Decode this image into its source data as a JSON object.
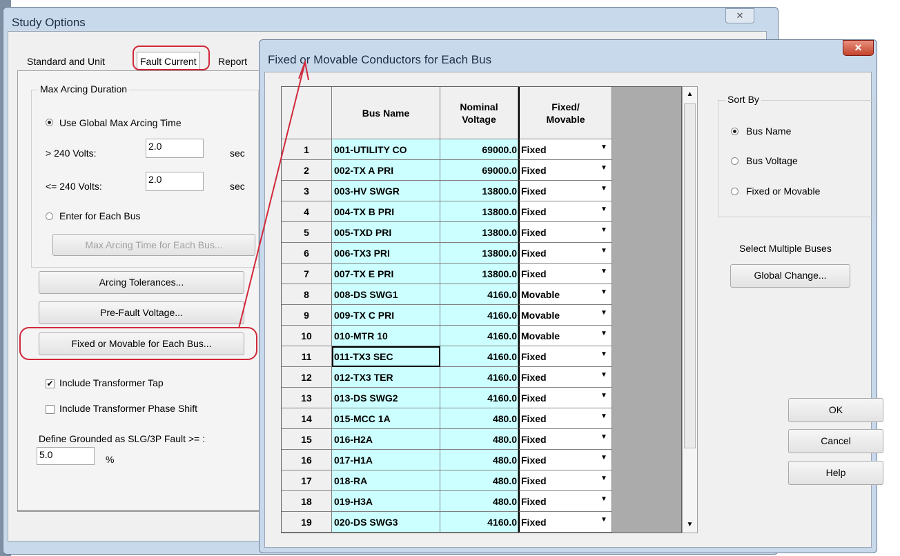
{
  "study_options": {
    "title": "Study Options",
    "close": "✕",
    "tabs": [
      "Standard and Unit",
      "Fault Current",
      "Report"
    ],
    "max_arcing": {
      "title": "Max Arcing Duration",
      "use_global_label": "Use Global Max Arcing Time",
      "gt_240_label": "> 240 Volts:",
      "gt_240_value": "2.0",
      "le_240_label": "<= 240 Volts:",
      "le_240_value": "2.0",
      "unit": "sec",
      "enter_each_label": "Enter for Each Bus",
      "max_each_button": "Max Arcing Time for Each Bus..."
    },
    "arcing_tolerances_button": "Arcing Tolerances...",
    "prefault_voltage_button": "Pre-Fault Voltage...",
    "fixed_movable_button": "Fixed or Movable for Each Bus...",
    "include_tap_label": "Include Transformer Tap",
    "include_shift_label": "Include Transformer Phase Shift",
    "grounded_label": "Define Grounded as SLG/3P Fault >= :",
    "grounded_value": "5.0",
    "grounded_unit": "%"
  },
  "fixed_movable_dialog": {
    "title": "Fixed or Movable Conductors for Each Bus",
    "close": "✕",
    "columns": [
      "Bus Name",
      "Nominal",
      "Voltage",
      "Fixed/",
      "Movable"
    ],
    "rows": [
      {
        "num": "1",
        "bus": "001-UTILITY CO",
        "voltage": "69000.0",
        "type": "Fixed"
      },
      {
        "num": "2",
        "bus": "002-TX A PRI",
        "voltage": "69000.0",
        "type": "Fixed"
      },
      {
        "num": "3",
        "bus": "003-HV SWGR",
        "voltage": "13800.0",
        "type": "Fixed"
      },
      {
        "num": "4",
        "bus": "004-TX B PRI",
        "voltage": "13800.0",
        "type": "Fixed"
      },
      {
        "num": "5",
        "bus": "005-TXD PRI",
        "voltage": "13800.0",
        "type": "Fixed"
      },
      {
        "num": "6",
        "bus": "006-TX3 PRI",
        "voltage": "13800.0",
        "type": "Fixed"
      },
      {
        "num": "7",
        "bus": "007-TX E PRI",
        "voltage": "13800.0",
        "type": "Fixed"
      },
      {
        "num": "8",
        "bus": "008-DS SWG1",
        "voltage": "4160.0",
        "type": "Movable"
      },
      {
        "num": "9",
        "bus": "009-TX C PRI",
        "voltage": "4160.0",
        "type": "Movable"
      },
      {
        "num": "10",
        "bus": "010-MTR 10",
        "voltage": "4160.0",
        "type": "Movable"
      },
      {
        "num": "11",
        "bus": "011-TX3 SEC",
        "voltage": "4160.0",
        "type": "Fixed"
      },
      {
        "num": "12",
        "bus": "012-TX3 TER",
        "voltage": "4160.0",
        "type": "Fixed"
      },
      {
        "num": "13",
        "bus": "013-DS SWG2",
        "voltage": "4160.0",
        "type": "Fixed"
      },
      {
        "num": "14",
        "bus": "015-MCC 1A",
        "voltage": "480.0",
        "type": "Fixed"
      },
      {
        "num": "15",
        "bus": "016-H2A",
        "voltage": "480.0",
        "type": "Fixed"
      },
      {
        "num": "16",
        "bus": "017-H1A",
        "voltage": "480.0",
        "type": "Fixed"
      },
      {
        "num": "17",
        "bus": "018-RA",
        "voltage": "480.0",
        "type": "Fixed"
      },
      {
        "num": "18",
        "bus": "019-H3A",
        "voltage": "480.0",
        "type": "Fixed"
      },
      {
        "num": "19",
        "bus": "020-DS SWG3",
        "voltage": "4160.0",
        "type": "Fixed"
      }
    ],
    "sort_by": {
      "title": "Sort By",
      "options": [
        "Bus Name",
        "Bus Voltage",
        "Fixed or Movable"
      ],
      "selected": "Bus Name"
    },
    "select_multiple_label": "Select Multiple Buses",
    "global_change_button": "Global Change...",
    "ok_button": "OK",
    "cancel_button": "Cancel",
    "help_button": "Help"
  }
}
